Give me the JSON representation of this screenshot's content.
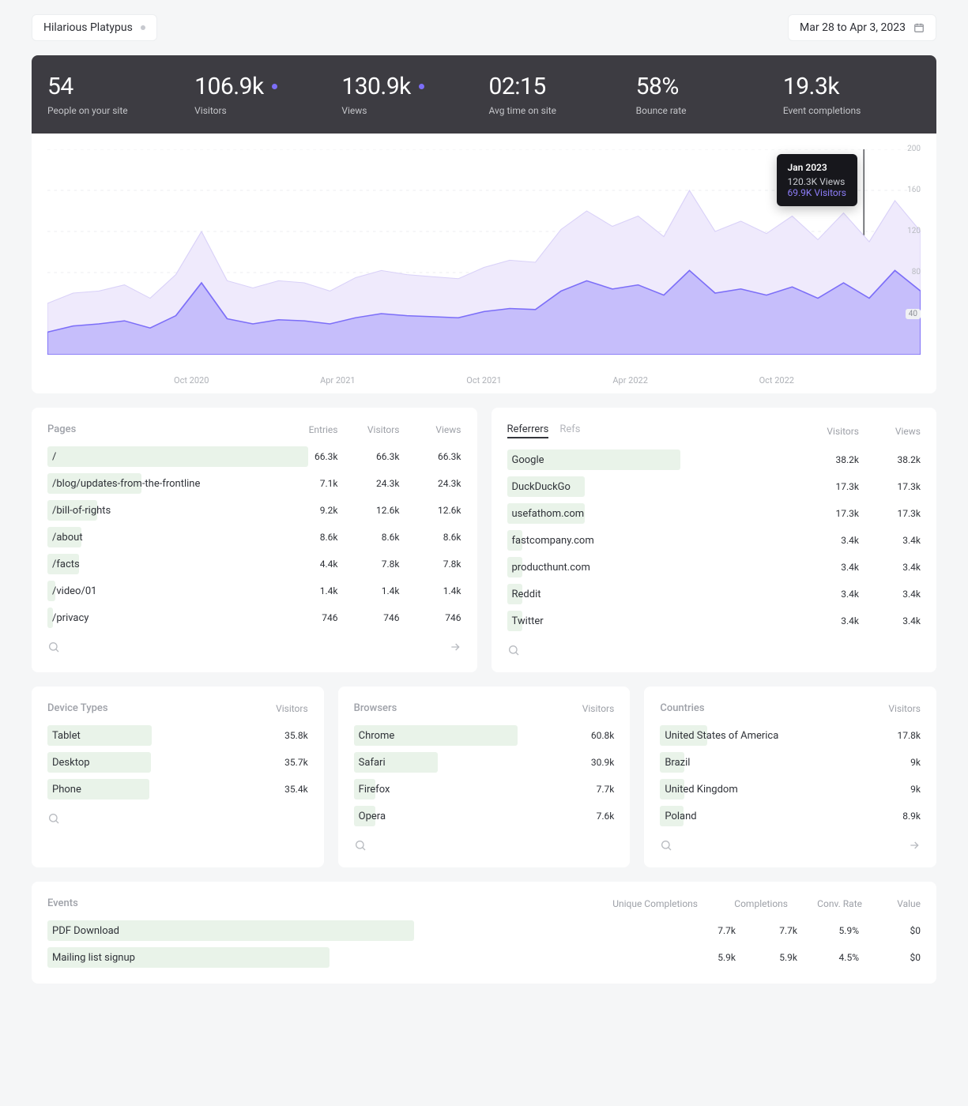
{
  "header": {
    "site_name": "Hilarious Platypus",
    "date_range": "Mar 28 to Apr 3, 2023"
  },
  "stats": [
    {
      "value": "54",
      "label": "People on your site",
      "dot": false
    },
    {
      "value": "106.9k",
      "label": "Visitors",
      "dot": true
    },
    {
      "value": "130.9k",
      "label": "Views",
      "dot": true
    },
    {
      "value": "02:15",
      "label": "Avg time on site",
      "dot": false
    },
    {
      "value": "58%",
      "label": "Bounce rate",
      "dot": false
    },
    {
      "value": "19.3k",
      "label": "Event completions",
      "dot": false
    }
  ],
  "tooltip": {
    "title": "Jan 2023",
    "views": "120.3K Views",
    "visitors": "69.9K Visitors"
  },
  "chart_data": {
    "type": "area",
    "x_ticks": [
      "Oct 2020",
      "Apr 2021",
      "Oct 2021",
      "Apr 2022",
      "Oct 2022"
    ],
    "y_ticks": [
      40,
      80,
      120,
      160,
      200
    ],
    "ylim": [
      0,
      200
    ],
    "series": [
      {
        "name": "Views",
        "color": "#efeafc",
        "values": [
          50,
          60,
          62,
          68,
          55,
          78,
          120,
          72,
          65,
          72,
          70,
          62,
          75,
          82,
          78,
          76,
          74,
          85,
          92,
          90,
          122,
          140,
          125,
          135,
          115,
          160,
          120,
          130,
          118,
          135,
          112,
          138,
          110,
          150,
          120
        ]
      },
      {
        "name": "Visitors",
        "color": "#7c6ef8",
        "values": [
          22,
          28,
          30,
          33,
          26,
          38,
          70,
          35,
          30,
          34,
          33,
          30,
          36,
          40,
          38,
          37,
          36,
          42,
          45,
          44,
          62,
          72,
          64,
          68,
          58,
          82,
          60,
          64,
          58,
          66,
          55,
          70,
          55,
          82,
          62
        ]
      }
    ]
  },
  "pages": {
    "title": "Pages",
    "cols": [
      "Entries",
      "Visitors",
      "Views"
    ],
    "rows": [
      {
        "label": "/",
        "vals": [
          "66.3k",
          "66.3k",
          "66.3k"
        ],
        "bar": 100
      },
      {
        "label": "/blog/updates-from-the-frontline",
        "vals": [
          "7.1k",
          "24.3k",
          "24.3k"
        ],
        "bar": 36
      },
      {
        "label": "/bill-of-rights",
        "vals": [
          "9.2k",
          "12.6k",
          "12.6k"
        ],
        "bar": 19
      },
      {
        "label": "/about",
        "vals": [
          "8.6k",
          "8.6k",
          "8.6k"
        ],
        "bar": 13
      },
      {
        "label": "/facts",
        "vals": [
          "4.4k",
          "7.8k",
          "7.8k"
        ],
        "bar": 12
      },
      {
        "label": "/video/01",
        "vals": [
          "1.4k",
          "1.4k",
          "1.4k"
        ],
        "bar": 3
      },
      {
        "label": "/privacy",
        "vals": [
          "746",
          "746",
          "746"
        ],
        "bar": 2
      }
    ]
  },
  "referrers": {
    "tabs": [
      "Referrers",
      "Refs"
    ],
    "cols": [
      "Visitors",
      "Views"
    ],
    "rows": [
      {
        "label": "Google",
        "vals": [
          "38.2k",
          "38.2k"
        ],
        "bar": 100
      },
      {
        "label": "DuckDuckGo",
        "vals": [
          "17.3k",
          "17.3k"
        ],
        "bar": 45
      },
      {
        "label": "usefathom.com",
        "vals": [
          "17.3k",
          "17.3k"
        ],
        "bar": 45
      },
      {
        "label": "fastcompany.com",
        "vals": [
          "3.4k",
          "3.4k"
        ],
        "bar": 9
      },
      {
        "label": "producthunt.com",
        "vals": [
          "3.4k",
          "3.4k"
        ],
        "bar": 9
      },
      {
        "label": "Reddit",
        "vals": [
          "3.4k",
          "3.4k"
        ],
        "bar": 9
      },
      {
        "label": "Twitter",
        "vals": [
          "3.4k",
          "3.4k"
        ],
        "bar": 9
      }
    ]
  },
  "devices": {
    "title": "Device Types",
    "cols": [
      "Visitors"
    ],
    "rows": [
      {
        "label": "Tablet",
        "vals": [
          "35.8k"
        ],
        "bar": 100
      },
      {
        "label": "Desktop",
        "vals": [
          "35.7k"
        ],
        "bar": 99
      },
      {
        "label": "Phone",
        "vals": [
          "35.4k"
        ],
        "bar": 98
      }
    ]
  },
  "browsers": {
    "title": "Browsers",
    "cols": [
      "Visitors"
    ],
    "rows": [
      {
        "label": "Chrome",
        "vals": [
          "60.8k"
        ],
        "bar": 100
      },
      {
        "label": "Safari",
        "vals": [
          "30.9k"
        ],
        "bar": 51
      },
      {
        "label": "Firefox",
        "vals": [
          "7.7k"
        ],
        "bar": 13
      },
      {
        "label": "Opera",
        "vals": [
          "7.6k"
        ],
        "bar": 13
      }
    ]
  },
  "countries": {
    "title": "Countries",
    "cols": [
      "Visitors"
    ],
    "rows": [
      {
        "label": "United States of America",
        "vals": [
          "17.8k"
        ],
        "bar": 100
      },
      {
        "label": "Brazil",
        "vals": [
          "9k"
        ],
        "bar": 51
      },
      {
        "label": "United Kingdom",
        "vals": [
          "9k"
        ],
        "bar": 51
      },
      {
        "label": "Poland",
        "vals": [
          "8.9k"
        ],
        "bar": 50
      }
    ]
  },
  "events": {
    "title": "Events",
    "cols": [
      "Unique Completions",
      "Completions",
      "Conv. Rate",
      "Value"
    ],
    "rows": [
      {
        "label": "PDF Download",
        "vals": [
          "7.7k",
          "7.7k",
          "5.9%",
          "$0"
        ],
        "bar": 100
      },
      {
        "label": "Mailing list signup",
        "vals": [
          "5.9k",
          "5.9k",
          "4.5%",
          "$0"
        ],
        "bar": 77
      }
    ]
  }
}
